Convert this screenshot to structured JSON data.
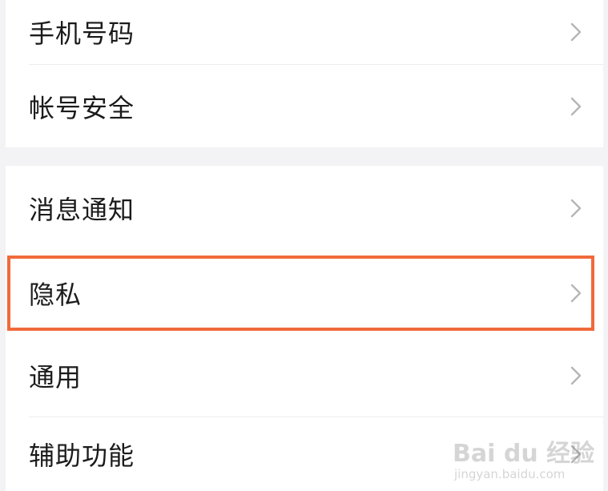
{
  "settings": {
    "items": [
      {
        "label": "手机号码"
      },
      {
        "label": "帐号安全"
      },
      {
        "label": "消息通知"
      },
      {
        "label": "隐私"
      },
      {
        "label": "通用"
      },
      {
        "label": "辅助功能"
      }
    ],
    "chevron_icon": "chevron-right-icon",
    "highlighted_item": "隐私"
  },
  "watermark": {
    "brand": "Bai du 经验",
    "url": "jingyan.baidu.com"
  },
  "colors": {
    "highlight": "#f06a3b",
    "separator": "#f3f3f5",
    "text": "#1b1b1b",
    "chevron": "#b5b5b5"
  }
}
